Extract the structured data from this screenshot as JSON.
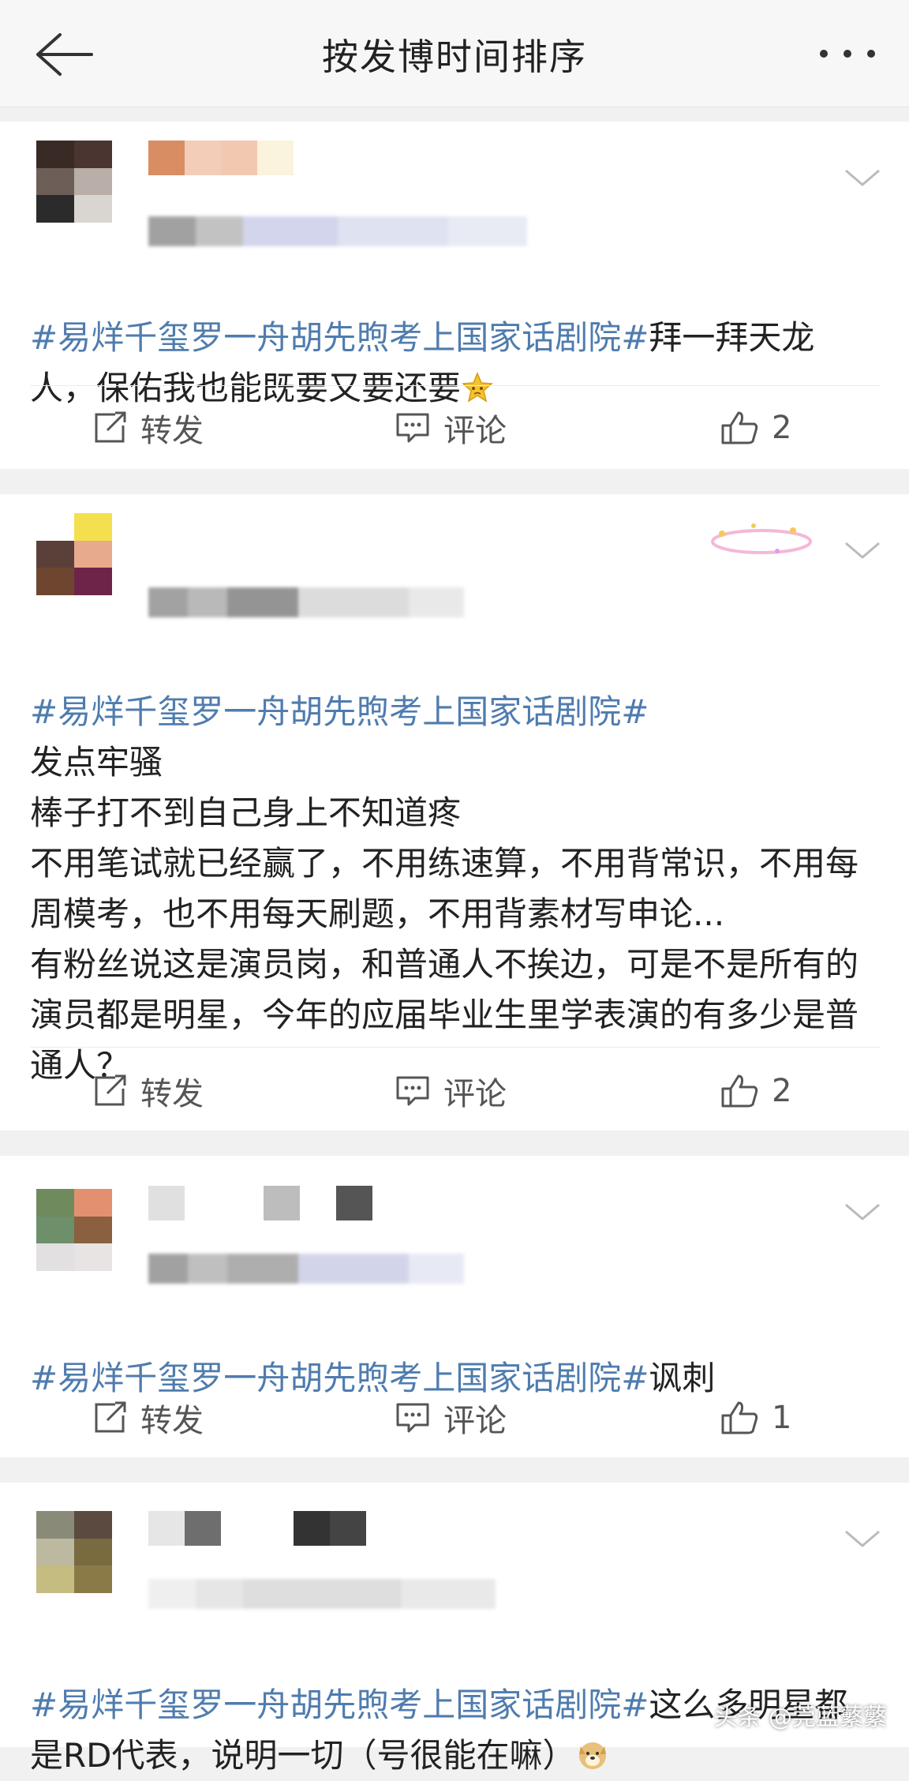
{
  "header": {
    "title": "按发博时间排序",
    "back_icon": "arrow-left-icon",
    "more_icon": "more-dots-icon"
  },
  "posts": [
    {
      "topic": "#易烊千玺罗一舟胡先煦考上国家话剧院#",
      "text": "拜一拜天龙人，保佑我也能既要又要还要",
      "emoji": "crying-star-emoji",
      "actions": {
        "repost": "转发",
        "comment": "评论",
        "like_count": "2"
      }
    },
    {
      "topic": "#易烊千玺罗一舟胡先煦考上国家话剧院#",
      "text": "发点牢骚\n棒子打不到自己身上不知道疼\n不用笔试就已经赢了，不用练速算，不用背常识，不用每周模考，也不用每天刷题，不用背素材写申论...\n有粉丝说这是演员岗，和普通人不挨边，可是不是所有的演员都是明星，今年的应届毕业生里学表演的有多少是普通人？",
      "actions": {
        "repost": "转发",
        "comment": "评论",
        "like_count": "2"
      }
    },
    {
      "topic": "#易烊千玺罗一舟胡先煦考上国家话剧院#",
      "text": "讽刺",
      "actions": {
        "repost": "转发",
        "comment": "评论",
        "like_count": "1"
      }
    },
    {
      "topic": "#易烊千玺罗一舟胡先煦考上国家话剧院#",
      "text": "这么多明星都是RD代表，说明一切（号很能在嘛）",
      "emoji": "doge-emoji"
    }
  ],
  "watermark": "头条 @莞蓝蘩蘩",
  "colors": {
    "topic": "#4f7cae",
    "background": "#f1f1f1",
    "header_bg": "#f7f7f7"
  }
}
